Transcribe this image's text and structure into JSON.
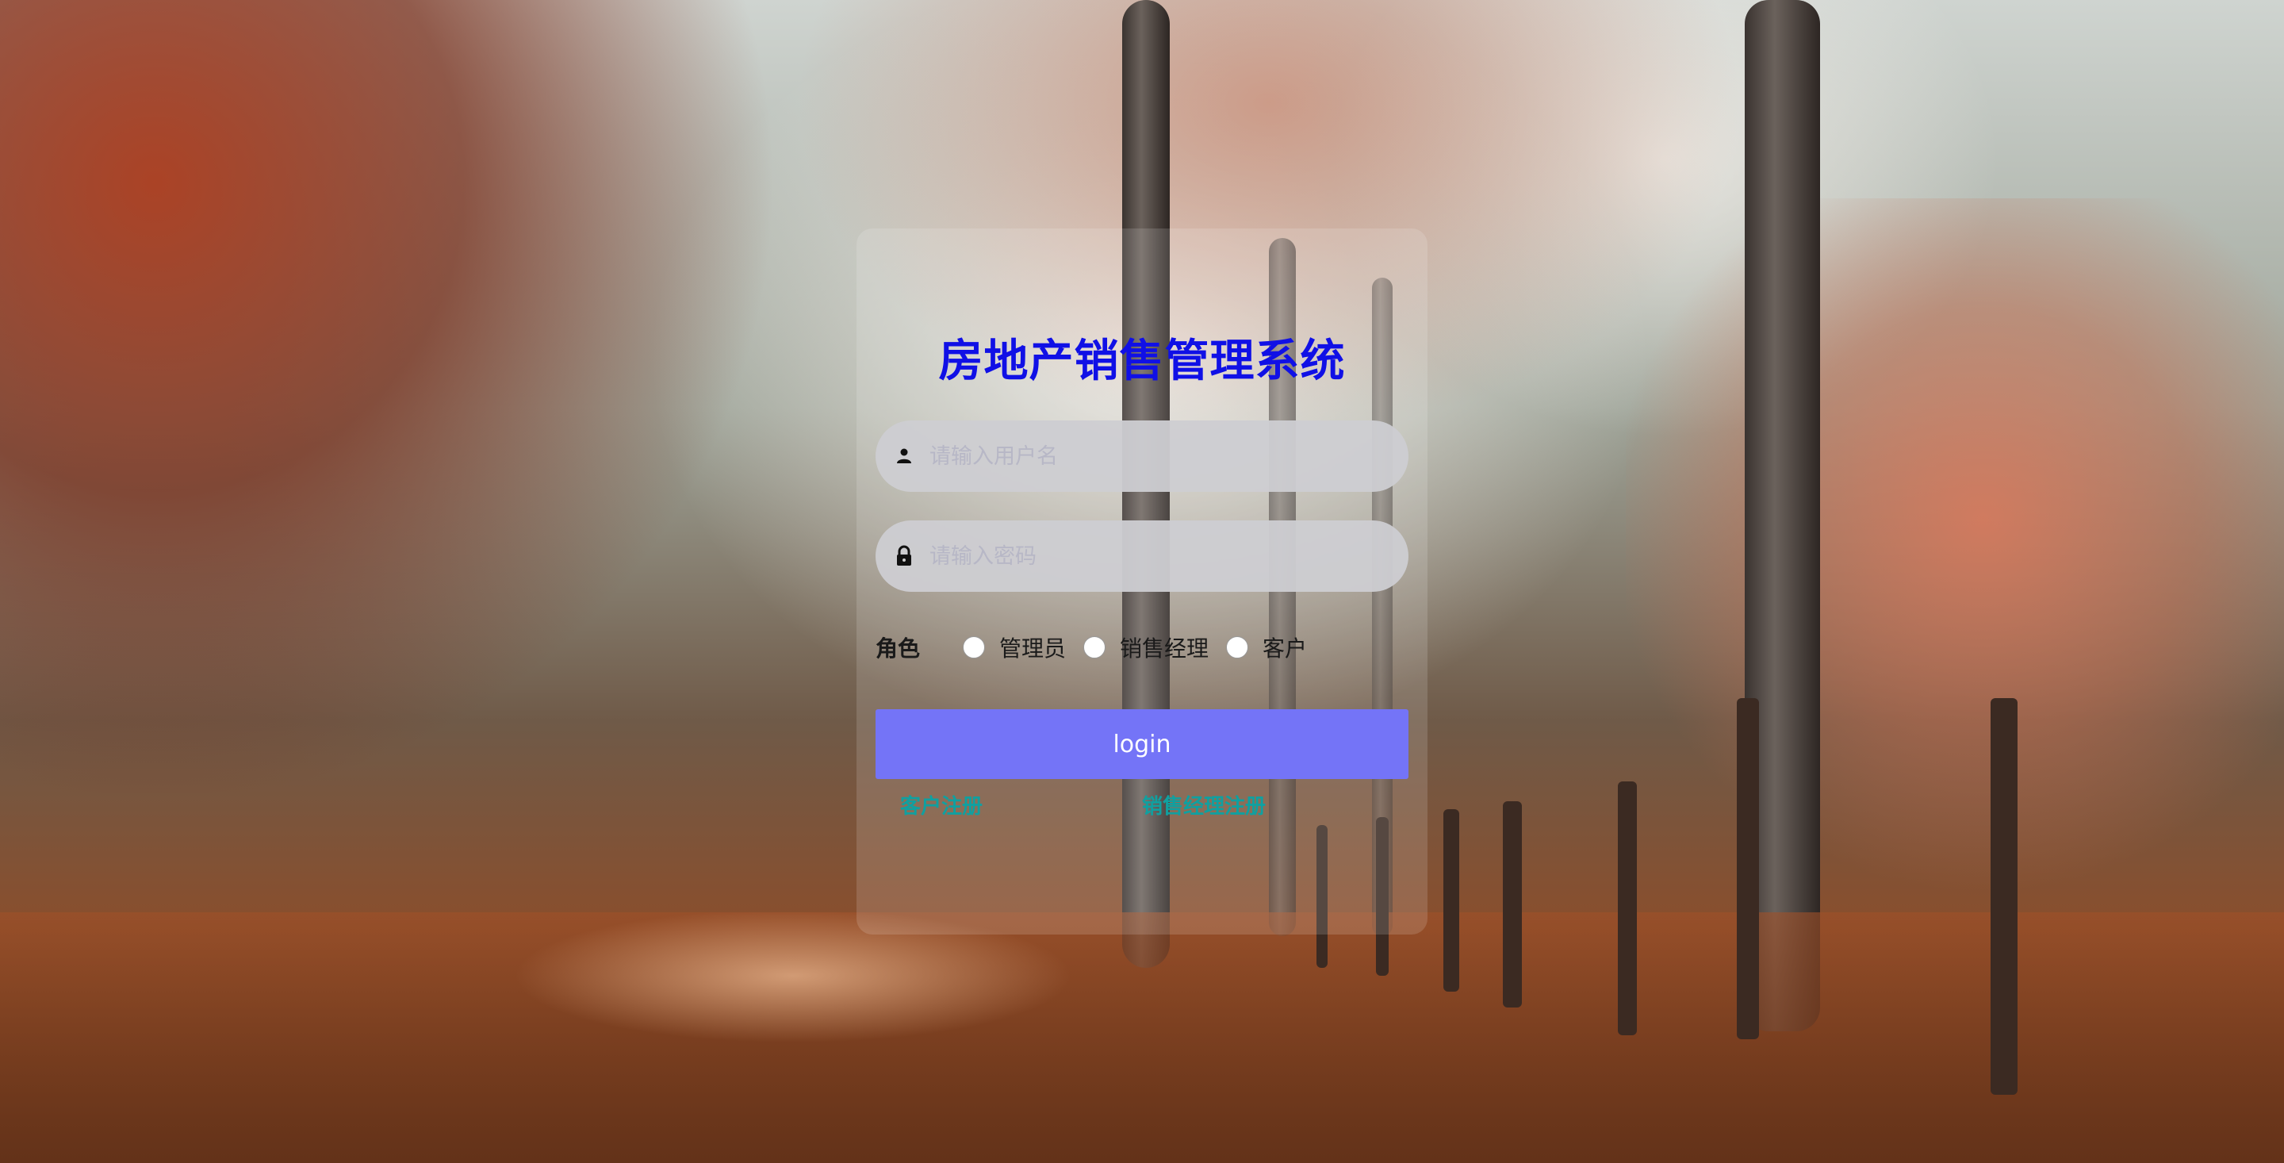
{
  "title": "房地产销售管理系统",
  "username": {
    "placeholder": "请输入用户名",
    "icon": "user-icon"
  },
  "password": {
    "placeholder": "请输入密码",
    "icon": "lock-icon"
  },
  "role": {
    "label": "角色",
    "options": [
      "管理员",
      "销售经理",
      "客户"
    ]
  },
  "login_label": "login",
  "links": {
    "customer_register": "客户注册",
    "manager_register": "销售经理注册"
  },
  "colors": {
    "title": "#1010e6",
    "login_button": "#7474f7",
    "link": "#10a0a0"
  }
}
